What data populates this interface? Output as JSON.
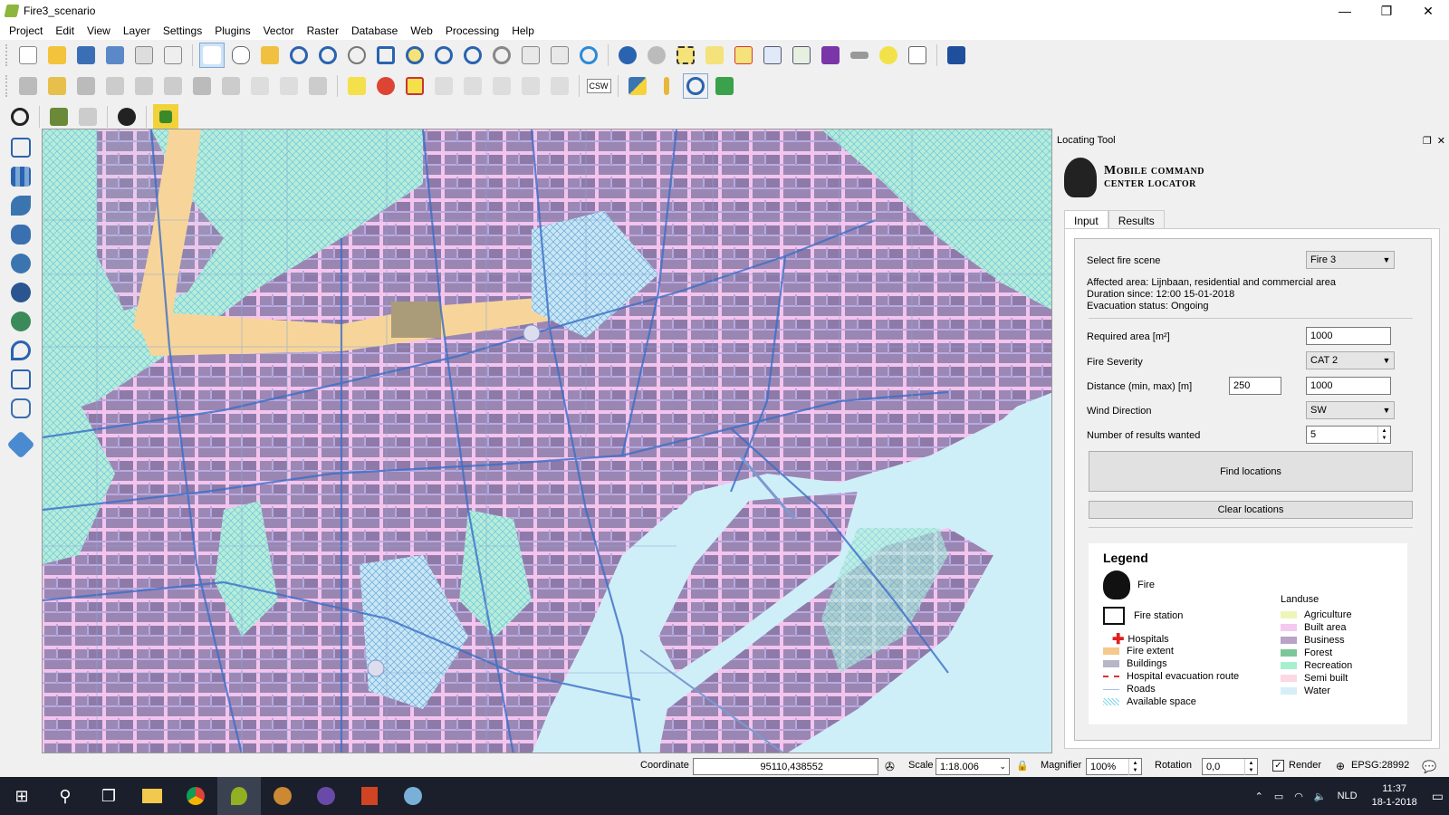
{
  "window": {
    "title": "Fire3_scenario",
    "minimize": "—",
    "maximize": "❐",
    "close": "✕"
  },
  "menu": [
    "Project",
    "Edit",
    "View",
    "Layer",
    "Settings",
    "Plugins",
    "Vector",
    "Raster",
    "Database",
    "Web",
    "Processing",
    "Help"
  ],
  "toolbar_label_csw": "CSW",
  "panel": {
    "title": "Locating Tool",
    "logo_line1": "Mobile command",
    "logo_line2": "center locator",
    "tabs": [
      "Input",
      "Results"
    ],
    "fire_scene_label": "Select fire scene",
    "fire_scene_value": "Fire 3",
    "affected_area": "Affected area: Lijnbaan, residential and commercial area",
    "duration": "Duration since: 12:00 15-01-2018",
    "evacuation": "Evacuation status: Ongoing",
    "required_area_label": "Required area [m²]",
    "required_area_value": "1000",
    "severity_label": "Fire Severity",
    "severity_value": "CAT 2",
    "distance_label": "Distance (min, max) [m]",
    "distance_min": "250",
    "distance_max": "1000",
    "wind_label": "Wind Direction",
    "wind_value": "SW",
    "results_label": "Number of results wanted",
    "results_value": "5",
    "find_button": "Find locations",
    "clear_button": "Clear locations"
  },
  "legend": {
    "title": "Legend",
    "fire": "Fire",
    "fire_station": "Fire station",
    "hospitals": "Hospitals",
    "fire_extent": "Fire extent",
    "buildings": "Buildings",
    "evac_route": "Hospital evacuation route",
    "roads": "Roads",
    "available_space": "Available space",
    "landuse_title": "Landuse",
    "landuse": [
      {
        "label": "Agriculture",
        "color": "#eef5b8"
      },
      {
        "label": "Built area",
        "color": "#f5c8f0"
      },
      {
        "label": "Business",
        "color": "#b9a3c8"
      },
      {
        "label": "Forest",
        "color": "#7bc79a"
      },
      {
        "label": "Recreation",
        "color": "#a8efd0"
      },
      {
        "label": "Semi built",
        "color": "#fbd8e4"
      },
      {
        "label": "Water",
        "color": "#d6eef8"
      }
    ],
    "colors": {
      "fire_extent": "#f5c98a",
      "buildings": "#b6b6c8",
      "evac": "#e03030",
      "roads": "#a8c0e0",
      "available": "#7fd6e8"
    }
  },
  "status": {
    "coordinate_label": "Coordinate",
    "coordinate_value": "95110,438552",
    "scale_label": "Scale",
    "scale_value": "1:18.006",
    "magnifier_label": "Magnifier",
    "magnifier_value": "100%",
    "rotation_label": "Rotation",
    "rotation_value": "0,0",
    "render_label": "Render",
    "crs": "EPSG:28992"
  },
  "taskbar": {
    "lang": "NLD",
    "time": "11:37",
    "date": "18-1-2018"
  }
}
